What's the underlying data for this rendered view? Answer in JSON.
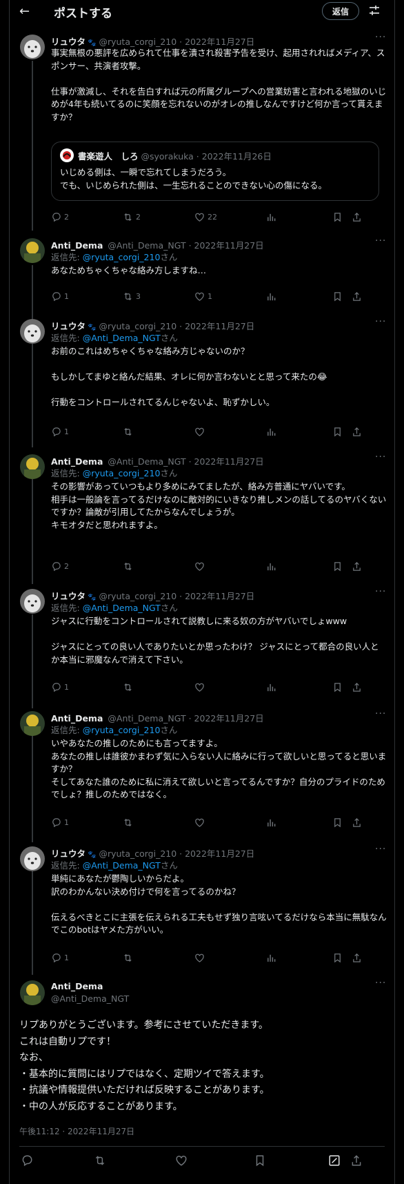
{
  "header": {
    "title": "ポストする",
    "reply_label": "返信"
  },
  "posts": [
    {
      "name": "リュウタ",
      "handle": "@ryuta_corgi_210",
      "date": "2022年11月27日",
      "text": "事実無根の悪評を広められて仕事を潰され殺害予告を受け、起用されればメディア、スポンサー、共演者攻撃。\n\n仕事が激減し、それを告白すれば元の所属グループへの営業妨害と言われる地獄のいじめが4年も続いてるのに笑顔を忘れないのがオレの推しなんですけど何か言って貰えますか？",
      "quote": {
        "name": "書楽遊人　しろ",
        "handle": "@syorakuka",
        "date": "2022年11月26日",
        "text": "いじめる側は、一瞬で忘れてしまうだろう。\nでも、いじめられた側は、一生忘れることのできない心の傷になる。"
      },
      "replies": "2",
      "reposts": "2",
      "likes": "22"
    },
    {
      "name": "Anti_Dema",
      "handle": "@Anti_Dema_NGT",
      "date": "2022年11月27日",
      "reply_prefix": "返信先: ",
      "reply_to": "@ryuta_corgi_210",
      "reply_suffix": "さん",
      "text": "あなためちゃくちゃな絡み方しますね…",
      "replies": "1",
      "reposts": "3",
      "likes": "1"
    },
    {
      "name": "リュウタ",
      "handle": "@ryuta_corgi_210",
      "date": "2022年11月27日",
      "reply_prefix": "返信先: ",
      "reply_to": "@Anti_Dema_NGT",
      "reply_suffix": "さん",
      "text": "お前のこれはめちゃくちゃな絡み方じゃないのか？\n\nもしかしてまゆと絡んだ結果、オレに何か言わないとと思って来たの😂\n\n行動をコントロールされてるんじゃないよ、恥ずかしい。",
      "replies": "1",
      "reposts": "",
      "likes": ""
    },
    {
      "name": "Anti_Dema",
      "handle": "@Anti_Dema_NGT",
      "date": "2022年11月27日",
      "reply_prefix": "返信先: ",
      "reply_to": "@ryuta_corgi_210",
      "reply_suffix": "さん",
      "text": "その影響があっていつもより多めにみてましたが、絡み方普通にヤバいです。\n相手は一般論を言ってるだけなのに敵対的にいきなり推しメンの話してるのヤバくないですか？論敵が引用してたからなんでしょうが。\nキモオタだと思われますよ。",
      "replies": "2",
      "reposts": "",
      "likes": ""
    },
    {
      "name": "リュウタ",
      "handle": "@ryuta_corgi_210",
      "date": "2022年11月27日",
      "reply_prefix": "返信先: ",
      "reply_to": "@Anti_Dema_NGT",
      "reply_suffix": "さん",
      "text": "ジャスに行動をコントロールされて説教しに来る奴の方がヤバいでしょwww\n\nジャスにとっての良い人でありたいとか思ったわけ？ ジャスにとって都合の良い人とか本当に邪魔なんで消えて下さい。",
      "replies": "1",
      "reposts": "",
      "likes": ""
    },
    {
      "name": "Anti_Dema",
      "handle": "@Anti_Dema_NGT",
      "date": "2022年11月27日",
      "reply_prefix": "返信先: ",
      "reply_to": "@ryuta_corgi_210",
      "reply_suffix": "さん",
      "text": "いやあなたの推しのためにも言ってますよ。\nあなたの推しは誰彼かまわず気に入らない人に絡みに行って欲しいと思ってると思いますか？\nそしてあなた誰のために私に消えて欲しいと言ってるんですか？自分のプライドのためでしょ？推しのためではなく。",
      "replies": "1",
      "reposts": "",
      "likes": ""
    },
    {
      "name": "リュウタ",
      "handle": "@ryuta_corgi_210",
      "date": "2022年11月27日",
      "reply_prefix": "返信先: ",
      "reply_to": "@Anti_Dema_NGT",
      "reply_suffix": "さん",
      "text": "単純にあなたが鬱陶しいからだよ。\n訳のわかんない決め付けで何を言ってるのかね？\n\n伝えるべきとこに主張を伝えられる工夫もせず独り言呟いてるだけなら本当に無駄なんでこのbotはヤメた方がいい。",
      "replies": "1",
      "reposts": "",
      "likes": ""
    }
  ],
  "main": {
    "name": "Anti_Dema",
    "handle": "@Anti_Dema_NGT",
    "text": "リプありがとうございます。参考にさせていただきます。\nこれは自動リプです！\nなお、\n・基本的に質問にはリプではなく、定期ツイで答えます。\n・抗議や情報提供いただければ反映することがあります。\n・中の人が反応することがあります。",
    "timestamp": "午後11:12 · 2022年11月27日"
  }
}
